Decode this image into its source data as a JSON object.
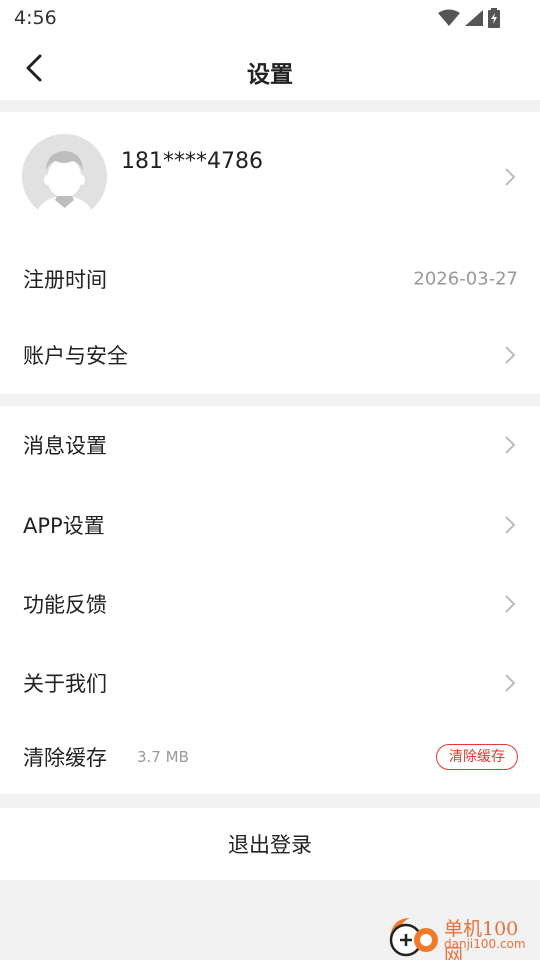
{
  "status_bar": {
    "time": "4:56"
  },
  "header": {
    "title": "设置"
  },
  "profile": {
    "phone": "181****4786"
  },
  "account_section": {
    "register_label": "注册时间",
    "register_date": "2026-03-27",
    "security_label": "账户与安全"
  },
  "settings_section": {
    "items": [
      {
        "label": "消息设置"
      },
      {
        "label": "APP设置"
      },
      {
        "label": "功能反馈"
      },
      {
        "label": "关于我们"
      }
    ],
    "cache": {
      "label": "清除缓存",
      "size": "3.7 MB",
      "button": "清除缓存"
    }
  },
  "logout": {
    "label": "退出登录"
  },
  "watermark": {
    "title": "单机100网",
    "url": "danji100.com"
  },
  "colors": {
    "accent_red": "#e53935",
    "watermark_orange": "#e8703a"
  },
  "icons": [
    "wifi-icon",
    "signal-icon",
    "battery-icon",
    "back-arrow-icon",
    "chevron-right-icon",
    "avatar-icon"
  ]
}
